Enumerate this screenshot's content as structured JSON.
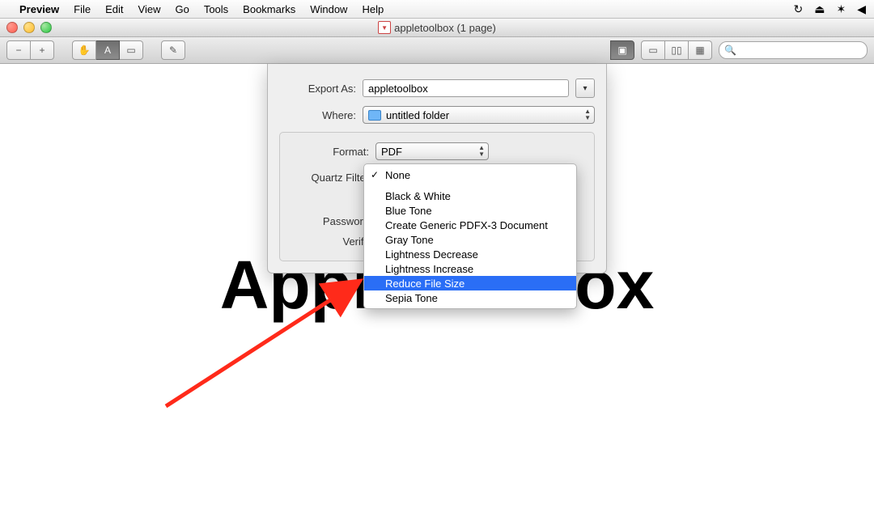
{
  "menubar": {
    "app": "Preview",
    "items": [
      "File",
      "Edit",
      "View",
      "Go",
      "Tools",
      "Bookmarks",
      "Window",
      "Help"
    ]
  },
  "window": {
    "title": "appletoolbox (1 page)"
  },
  "export": {
    "exportAsLabel": "Export As:",
    "exportAsValue": "appletoolbox",
    "whereLabel": "Where:",
    "whereValue": "untitled folder",
    "formatLabel": "Format:",
    "formatValue": "PDF",
    "quartzLabel": "Quartz Filter",
    "passwordLabel": "Password",
    "verifyLabel": "Verify"
  },
  "quartzMenu": {
    "items": [
      "None",
      "Black & White",
      "Blue Tone",
      "Create Generic PDFX-3 Document",
      "Gray Tone",
      "Lightness Decrease",
      "Lightness Increase",
      "Reduce File Size",
      "Sepia Tone"
    ],
    "checkedIndex": 0,
    "highlightedIndex": 7
  },
  "bg": {
    "text": "Appletoolbox"
  }
}
